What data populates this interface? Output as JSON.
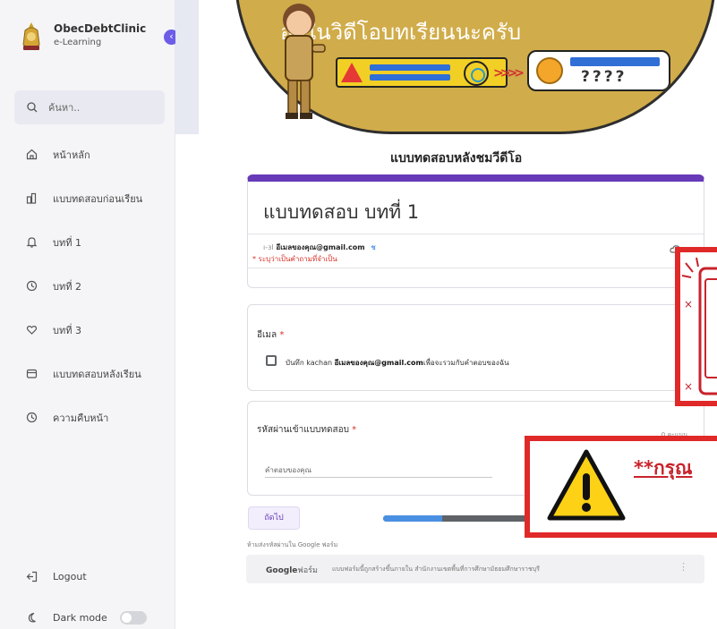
{
  "sidebar": {
    "brand_title": "ObecDebtClinic",
    "brand_subtitle": "e-Learning",
    "search_label": "ค้นหา..",
    "items": [
      {
        "label": "หน้าหลัก",
        "icon": "home-icon"
      },
      {
        "label": "แบบทดสอบก่อนเรียน",
        "icon": "test-icon"
      },
      {
        "label": "บทที่ 1",
        "icon": "bell-icon"
      },
      {
        "label": "บทที่ 2",
        "icon": "clock-icon"
      },
      {
        "label": "บทที่ 3",
        "icon": "heart-icon"
      },
      {
        "label": "แบบทดสอบหลังเรียน",
        "icon": "wallet-icon"
      },
      {
        "label": "ความคืบหน้า",
        "icon": "clock-icon"
      }
    ],
    "logout_label": "Logout",
    "darkmode_label": "Dark mode"
  },
  "banner": {
    "text": "อยู่ในวิดีโอบทเรียนนะครับ",
    "code_placeholder": "????"
  },
  "page_heading": "แบบทดสอบหลังชมวีดีโอ",
  "form": {
    "title": "แบบทดสอบ บทที่ 1",
    "email_prefix": "ı-ɜl",
    "email": "อีเมลของคุณ@gmail.com",
    "switch_label": "ช",
    "required_note": "* ระบุว่าเป็นคำถามที่จำเป็น",
    "email_question": "อีเมล",
    "required_mark": "*",
    "record_prefix": "บันทึก kachan",
    "record_email": "อีเมลของคุณ@gmail.com",
    "record_suffix": "เพื่อจะรวมกับคำตอบของฉัน",
    "password_question": "รหัสผ่านเข้าแบบทดสอบ",
    "points": "0 คะแนน",
    "answer_placeholder": "คำตอบของคุณ",
    "next_label": "ถัดไป",
    "progress_fraction": 0.4,
    "progress_text": "ห",
    "gforms_note": "ห้ามส่งรหัสผ่านใน Google ฟอร์ม",
    "footer_brand": "Google",
    "footer_brand_suffix": "ฟอร์ม",
    "footer_text": "แบบฟอร์มนี้ถูกสร้างขึ้นภายใน สำนักงานเขตพื้นที่การศึกษามัธยมศึกษาราชบุรี"
  },
  "overlay": {
    "big_title": "**กรุณ"
  },
  "colors": {
    "accent": "#673ab7",
    "alert": "#e02929",
    "banner": "#d0ac4a"
  }
}
